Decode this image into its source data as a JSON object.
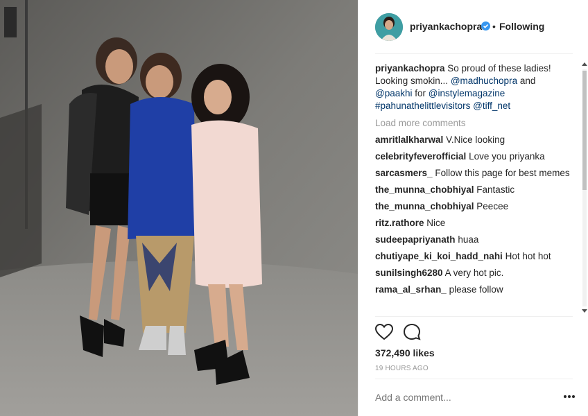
{
  "post": {
    "username": "priyankachopra",
    "follow_separator": "•",
    "follow_label": "Following",
    "caption": {
      "username": "priyankachopra",
      "text_1": " So proud of these ladies! Looking smokin... ",
      "mention_1": "@madhuchopra",
      "text_2": " and ",
      "mention_2": "@paakhi",
      "text_3": " for ",
      "mention_3": "@instylemagazine",
      "text_4": " ",
      "hashtag": "#pahunathelittlevisitors",
      "text_5": " ",
      "mention_4": "@tiff_net"
    },
    "load_more": "Load more comments",
    "comments": [
      {
        "user": "amritlalkharwal",
        "text": "V.Nice looking"
      },
      {
        "user": "celebrityfeverofficial",
        "text": "Love you priyanka"
      },
      {
        "user": "sarcasmers_",
        "text": "Follow this page for best memes"
      },
      {
        "user": "the_munna_chobhiyal",
        "text": "Fantastic"
      },
      {
        "user": "the_munna_chobhiyal",
        "text": "Peecee"
      },
      {
        "user": "ritz.rathore",
        "text": "Nice"
      },
      {
        "user": "sudeepapriyanath",
        "text": "huaa"
      },
      {
        "user": "chutiyape_ki_koi_hadd_nahi",
        "text": "Hot hot hot"
      },
      {
        "user": "sunilsingh6280",
        "text": "A very hot pic."
      },
      {
        "user": "rama_al_srhan_",
        "text": "please follow"
      }
    ],
    "likes": "372,490 likes",
    "time": "19 HOURS AGO",
    "add_comment_placeholder": "Add a comment...",
    "icons": {
      "like": "heart-icon",
      "comment": "comment-icon",
      "verified": "verified-badge-icon",
      "more": "more-options-icon"
    },
    "colors": {
      "link": "#003569",
      "verified": "#3897f0",
      "muted": "#999999",
      "text": "#262626"
    }
  }
}
